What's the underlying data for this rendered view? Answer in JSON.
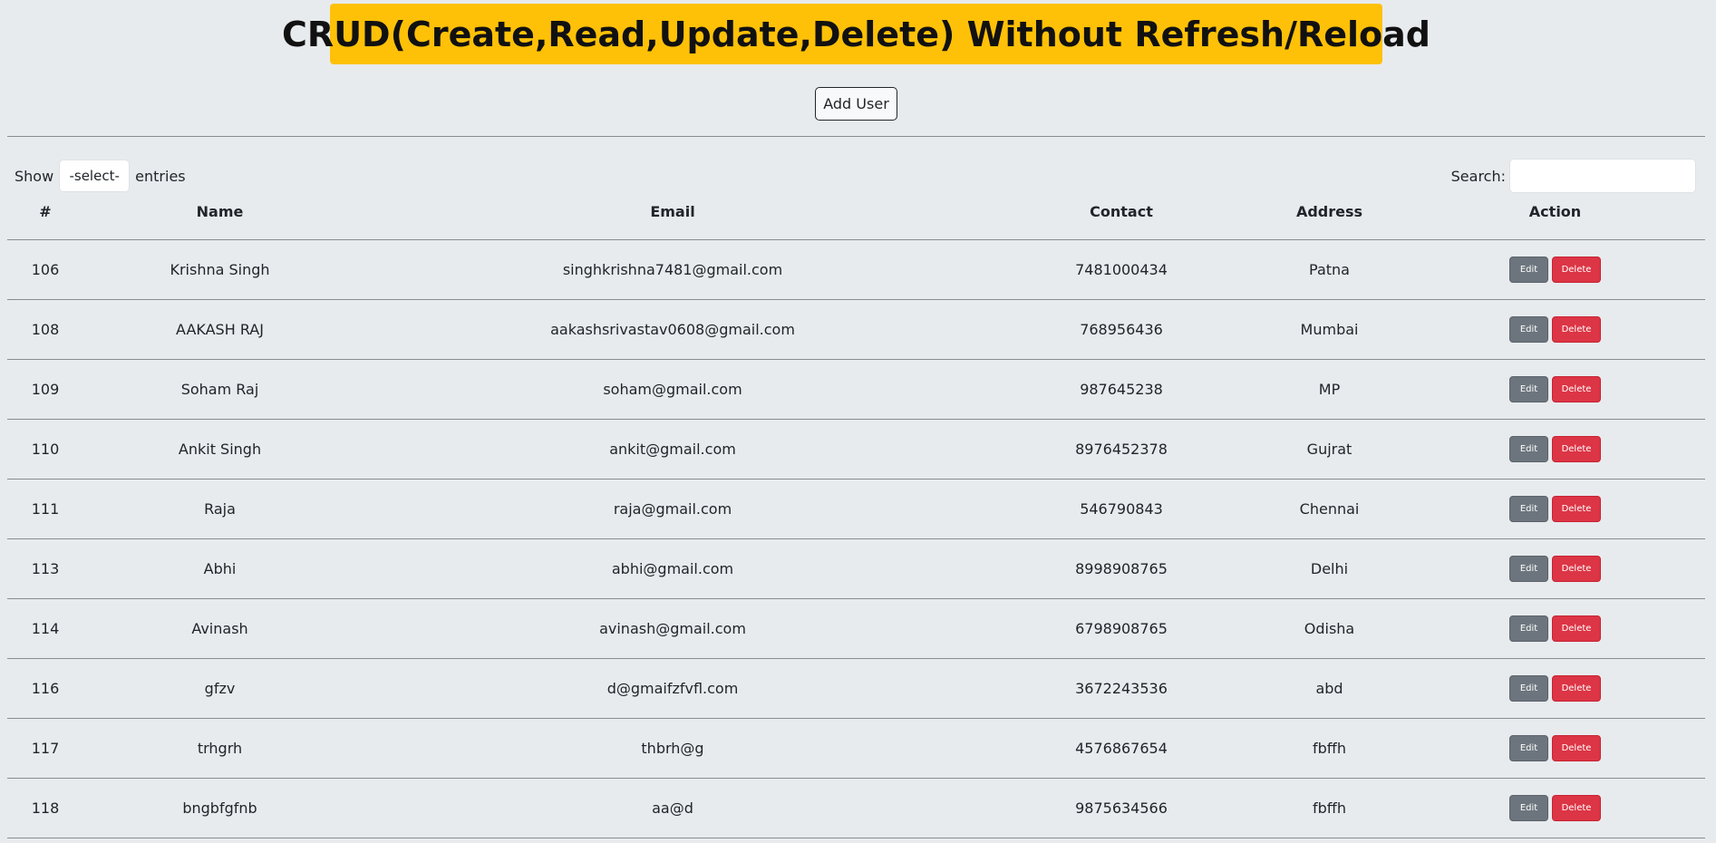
{
  "header": {
    "title": "CRUD(Create,Read,Update,Delete) Without Refresh/Reload",
    "add_user_label": "Add User"
  },
  "controls": {
    "show_label": "Show",
    "entries_selected": "-select-",
    "entries_label": "entries",
    "search_label": "Search:",
    "search_value": ""
  },
  "table": {
    "columns": [
      "#",
      "Name",
      "Email",
      "Contact",
      "Address",
      "Action"
    ],
    "rows": [
      {
        "id": "106",
        "name": "Krishna Singh",
        "email": "singhkrishna7481@gmail.com",
        "contact": "7481000434",
        "address": "Patna"
      },
      {
        "id": "108",
        "name": "AAKASH RAJ",
        "email": "aakashsrivastav0608@gmail.com",
        "contact": "768956436",
        "address": "Mumbai"
      },
      {
        "id": "109",
        "name": "Soham Raj",
        "email": "soham@gmail.com",
        "contact": "987645238",
        "address": "MP"
      },
      {
        "id": "110",
        "name": "Ankit Singh",
        "email": "ankit@gmail.com",
        "contact": "8976452378",
        "address": "Gujrat"
      },
      {
        "id": "111",
        "name": "Raja",
        "email": "raja@gmail.com",
        "contact": "546790843",
        "address": "Chennai"
      },
      {
        "id": "113",
        "name": "Abhi",
        "email": "abhi@gmail.com",
        "contact": "8998908765",
        "address": "Delhi"
      },
      {
        "id": "114",
        "name": "Avinash",
        "email": "avinash@gmail.com",
        "contact": "6798908765",
        "address": "Odisha"
      },
      {
        "id": "116",
        "name": "gfzv",
        "email": "d@gmaifzfvfl.com",
        "contact": "3672243536",
        "address": "abd"
      },
      {
        "id": "117",
        "name": "trhgrh",
        "email": "thbrh@g",
        "contact": "4576867654",
        "address": "fbffh"
      },
      {
        "id": "118",
        "name": "bngbfgfnb",
        "email": "aa@d",
        "contact": "9875634566",
        "address": "fbffh"
      }
    ],
    "edit_label": "Edit",
    "delete_label": "Delete"
  },
  "colors": {
    "page_background": "#e8ebee",
    "banner": "#ffc107",
    "edit_button": "#6c757d",
    "delete_button": "#dc3545"
  }
}
